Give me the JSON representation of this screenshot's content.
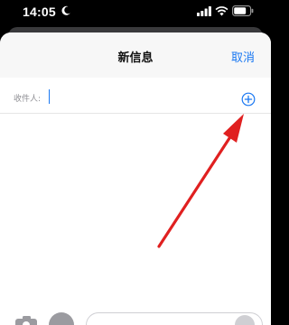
{
  "status_bar": {
    "time": "14:05",
    "icons": [
      "moon-icon",
      "signal-icon",
      "wifi-icon",
      "battery-icon"
    ]
  },
  "compose": {
    "title": "新信息",
    "cancel_label": "取消",
    "recipient_label": "收件人:",
    "recipient_value": "",
    "message_value": ""
  },
  "colors": {
    "accent": "#1a78f2",
    "annotation_arrow": "#e02020",
    "nav_background": "#f7f7f7",
    "status_bar_background": "#000000"
  }
}
